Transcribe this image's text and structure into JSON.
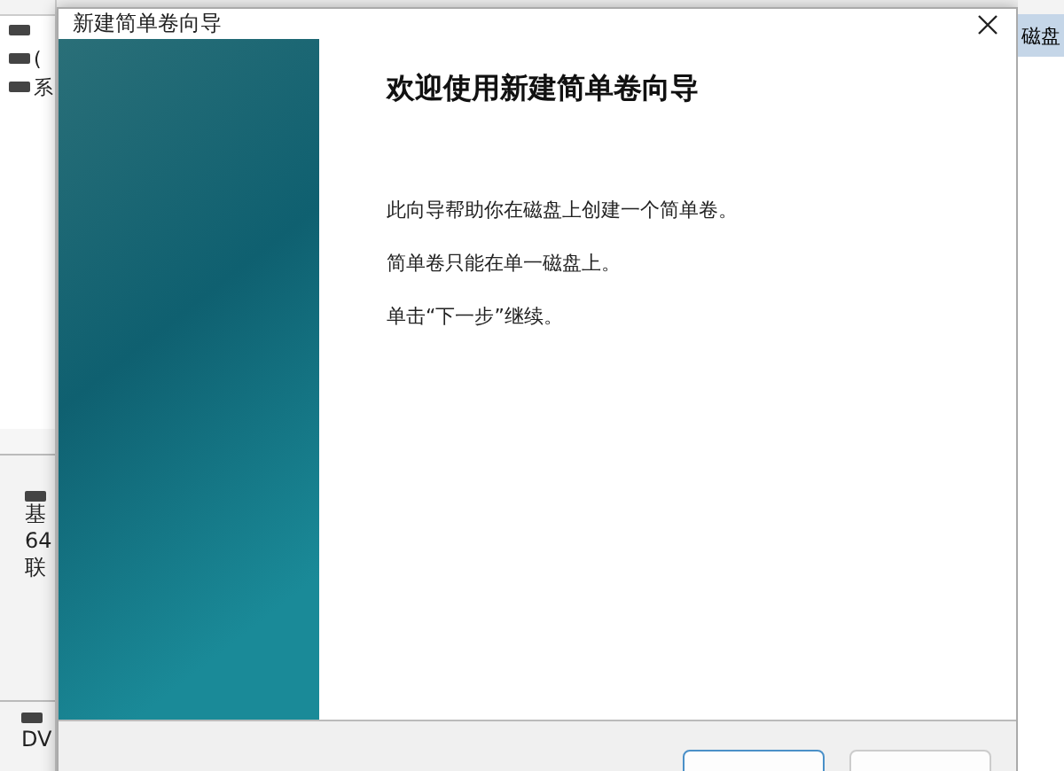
{
  "background": {
    "volume_labels": [
      "(",
      "系"
    ],
    "disk_lines": [
      "基",
      "64",
      "联"
    ],
    "dvd_label": "DV",
    "right_header": "磁盘"
  },
  "window": {
    "title": "新建简单卷向导"
  },
  "wizard": {
    "heading": "欢迎使用新建简单卷向导",
    "paragraphs": [
      "此向导帮助你在磁盘上创建一个简单卷。",
      "简单卷只能在单一磁盘上。",
      "单击“下一步”继续。"
    ]
  },
  "buttons": [
    {
      "default": true
    },
    {
      "default": false
    }
  ]
}
